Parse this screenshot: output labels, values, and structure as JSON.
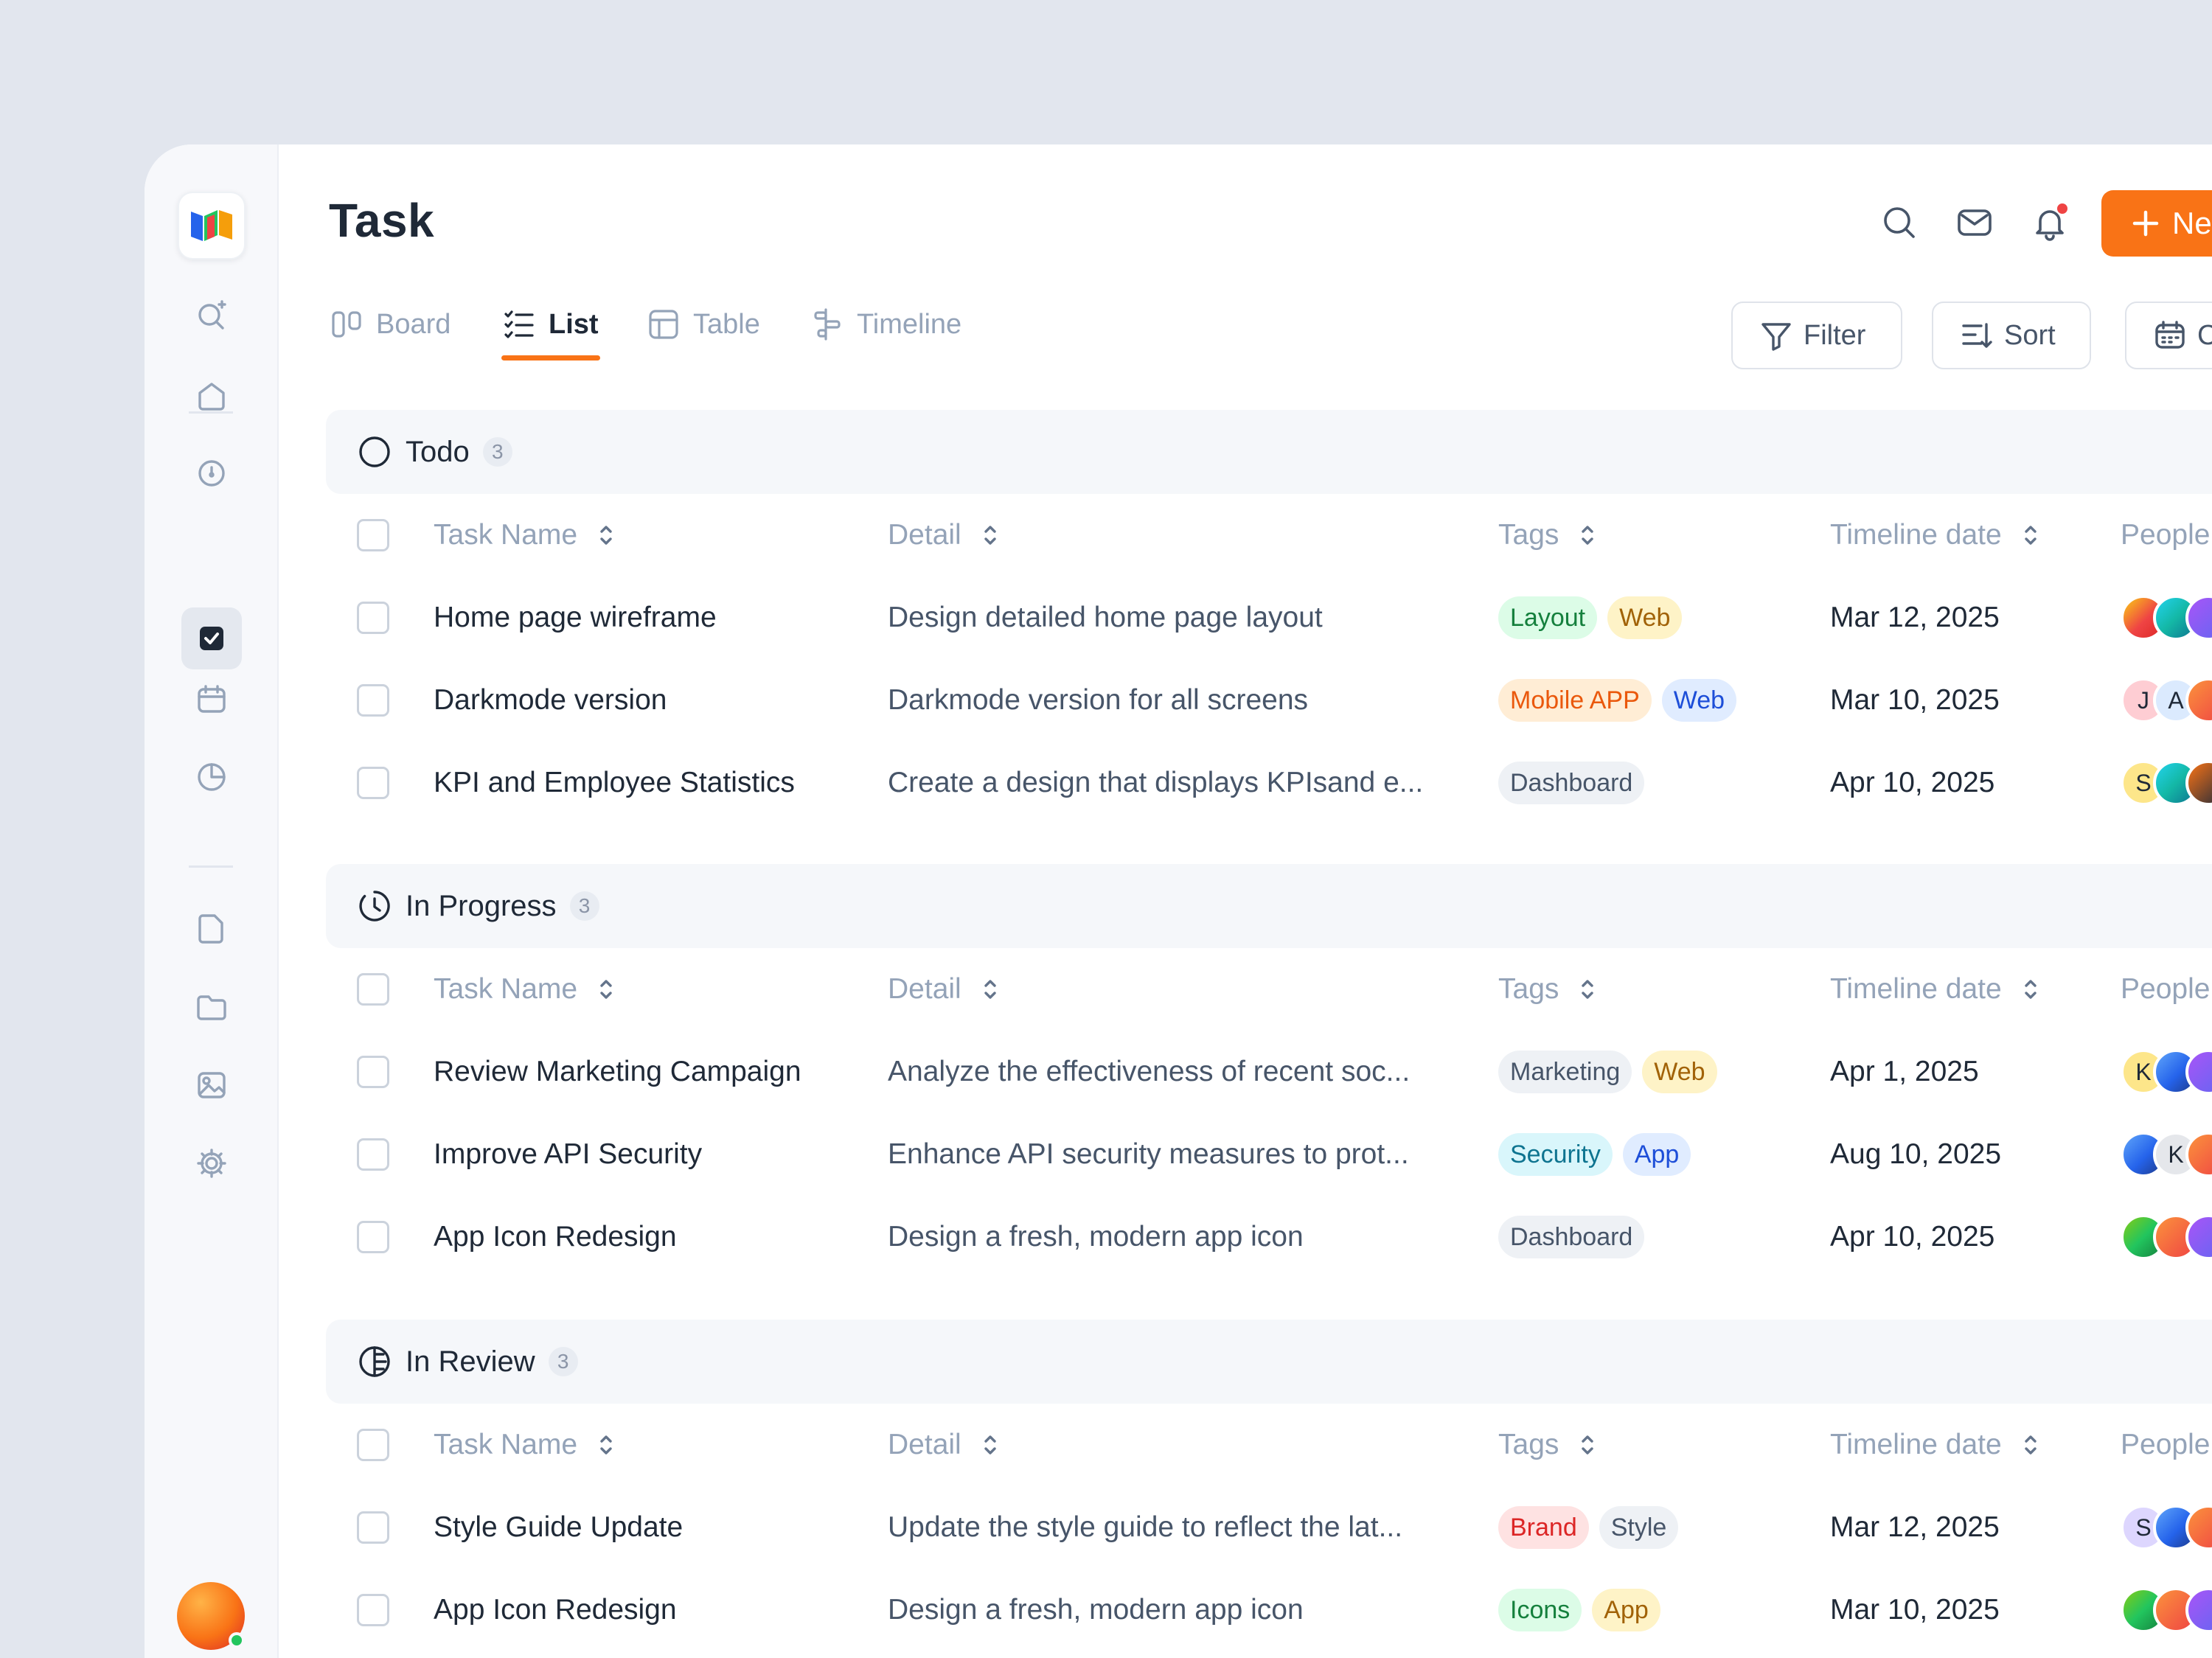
{
  "page": {
    "title": "Task"
  },
  "header": {
    "new_label": "Ne"
  },
  "tabs": [
    {
      "label": "Board",
      "icon": "board-icon"
    },
    {
      "label": "List",
      "icon": "list-icon"
    },
    {
      "label": "Table",
      "icon": "table-icon"
    },
    {
      "label": "Timeline",
      "icon": "timeline-icon"
    }
  ],
  "toolbar": {
    "filter_label": "Filter",
    "sort_label": "Sort",
    "calendar_label": "C"
  },
  "columns": {
    "name": "Task Name",
    "detail": "Detail",
    "tags": "Tags",
    "date": "Timeline date",
    "people": "People"
  },
  "groups": [
    {
      "name": "Todo",
      "count": "3",
      "rows": [
        {
          "name": "Home page wireframe",
          "detail": "Design detailed home page layout",
          "tags": [
            "Layout",
            "Web"
          ],
          "date": "Mar 12, 2025"
        },
        {
          "name": "Darkmode version",
          "detail": "Darkmode version for all screens",
          "tags": [
            "Mobile APP",
            "Web"
          ],
          "date": "Mar 10, 2025",
          "people": [
            "J",
            "A"
          ]
        },
        {
          "name": "KPI and Employee Statistics",
          "detail": "Create a design that displays KPIsand e...",
          "tags": [
            "Dashboard"
          ],
          "date": "Apr 10, 2025",
          "people": [
            "S"
          ]
        }
      ]
    },
    {
      "name": "In Progress",
      "count": "3",
      "rows": [
        {
          "name": "Review Marketing Campaign",
          "detail": "Analyze the effectiveness of recent soc...",
          "tags": [
            "Marketing",
            "Web"
          ],
          "date": "Apr 1, 2025",
          "people": [
            "K"
          ]
        },
        {
          "name": "Improve API Security",
          "detail": "Enhance API security measures to prot...",
          "tags": [
            "Security",
            "App"
          ],
          "date": "Aug 10, 2025",
          "people": [
            "K"
          ]
        },
        {
          "name": "App Icon Redesign",
          "detail": "Design a fresh, modern app icon",
          "tags": [
            "Dashboard"
          ],
          "date": "Apr 10, 2025"
        }
      ]
    },
    {
      "name": "In Review",
      "count": "3",
      "rows": [
        {
          "name": "Style Guide Update",
          "detail": "Update the style guide to reflect the lat...",
          "tags": [
            "Brand",
            "Style"
          ],
          "date": "Mar 12, 2025",
          "people": [
            "S"
          ]
        },
        {
          "name": "App Icon Redesign",
          "detail": "Design a fresh, modern app icon",
          "tags": [
            "Icons",
            "App"
          ],
          "date": "Mar 10, 2025"
        }
      ]
    }
  ],
  "colors": {
    "accent": "#f97316",
    "notification": "#ef4444",
    "online": "#22c55e"
  }
}
